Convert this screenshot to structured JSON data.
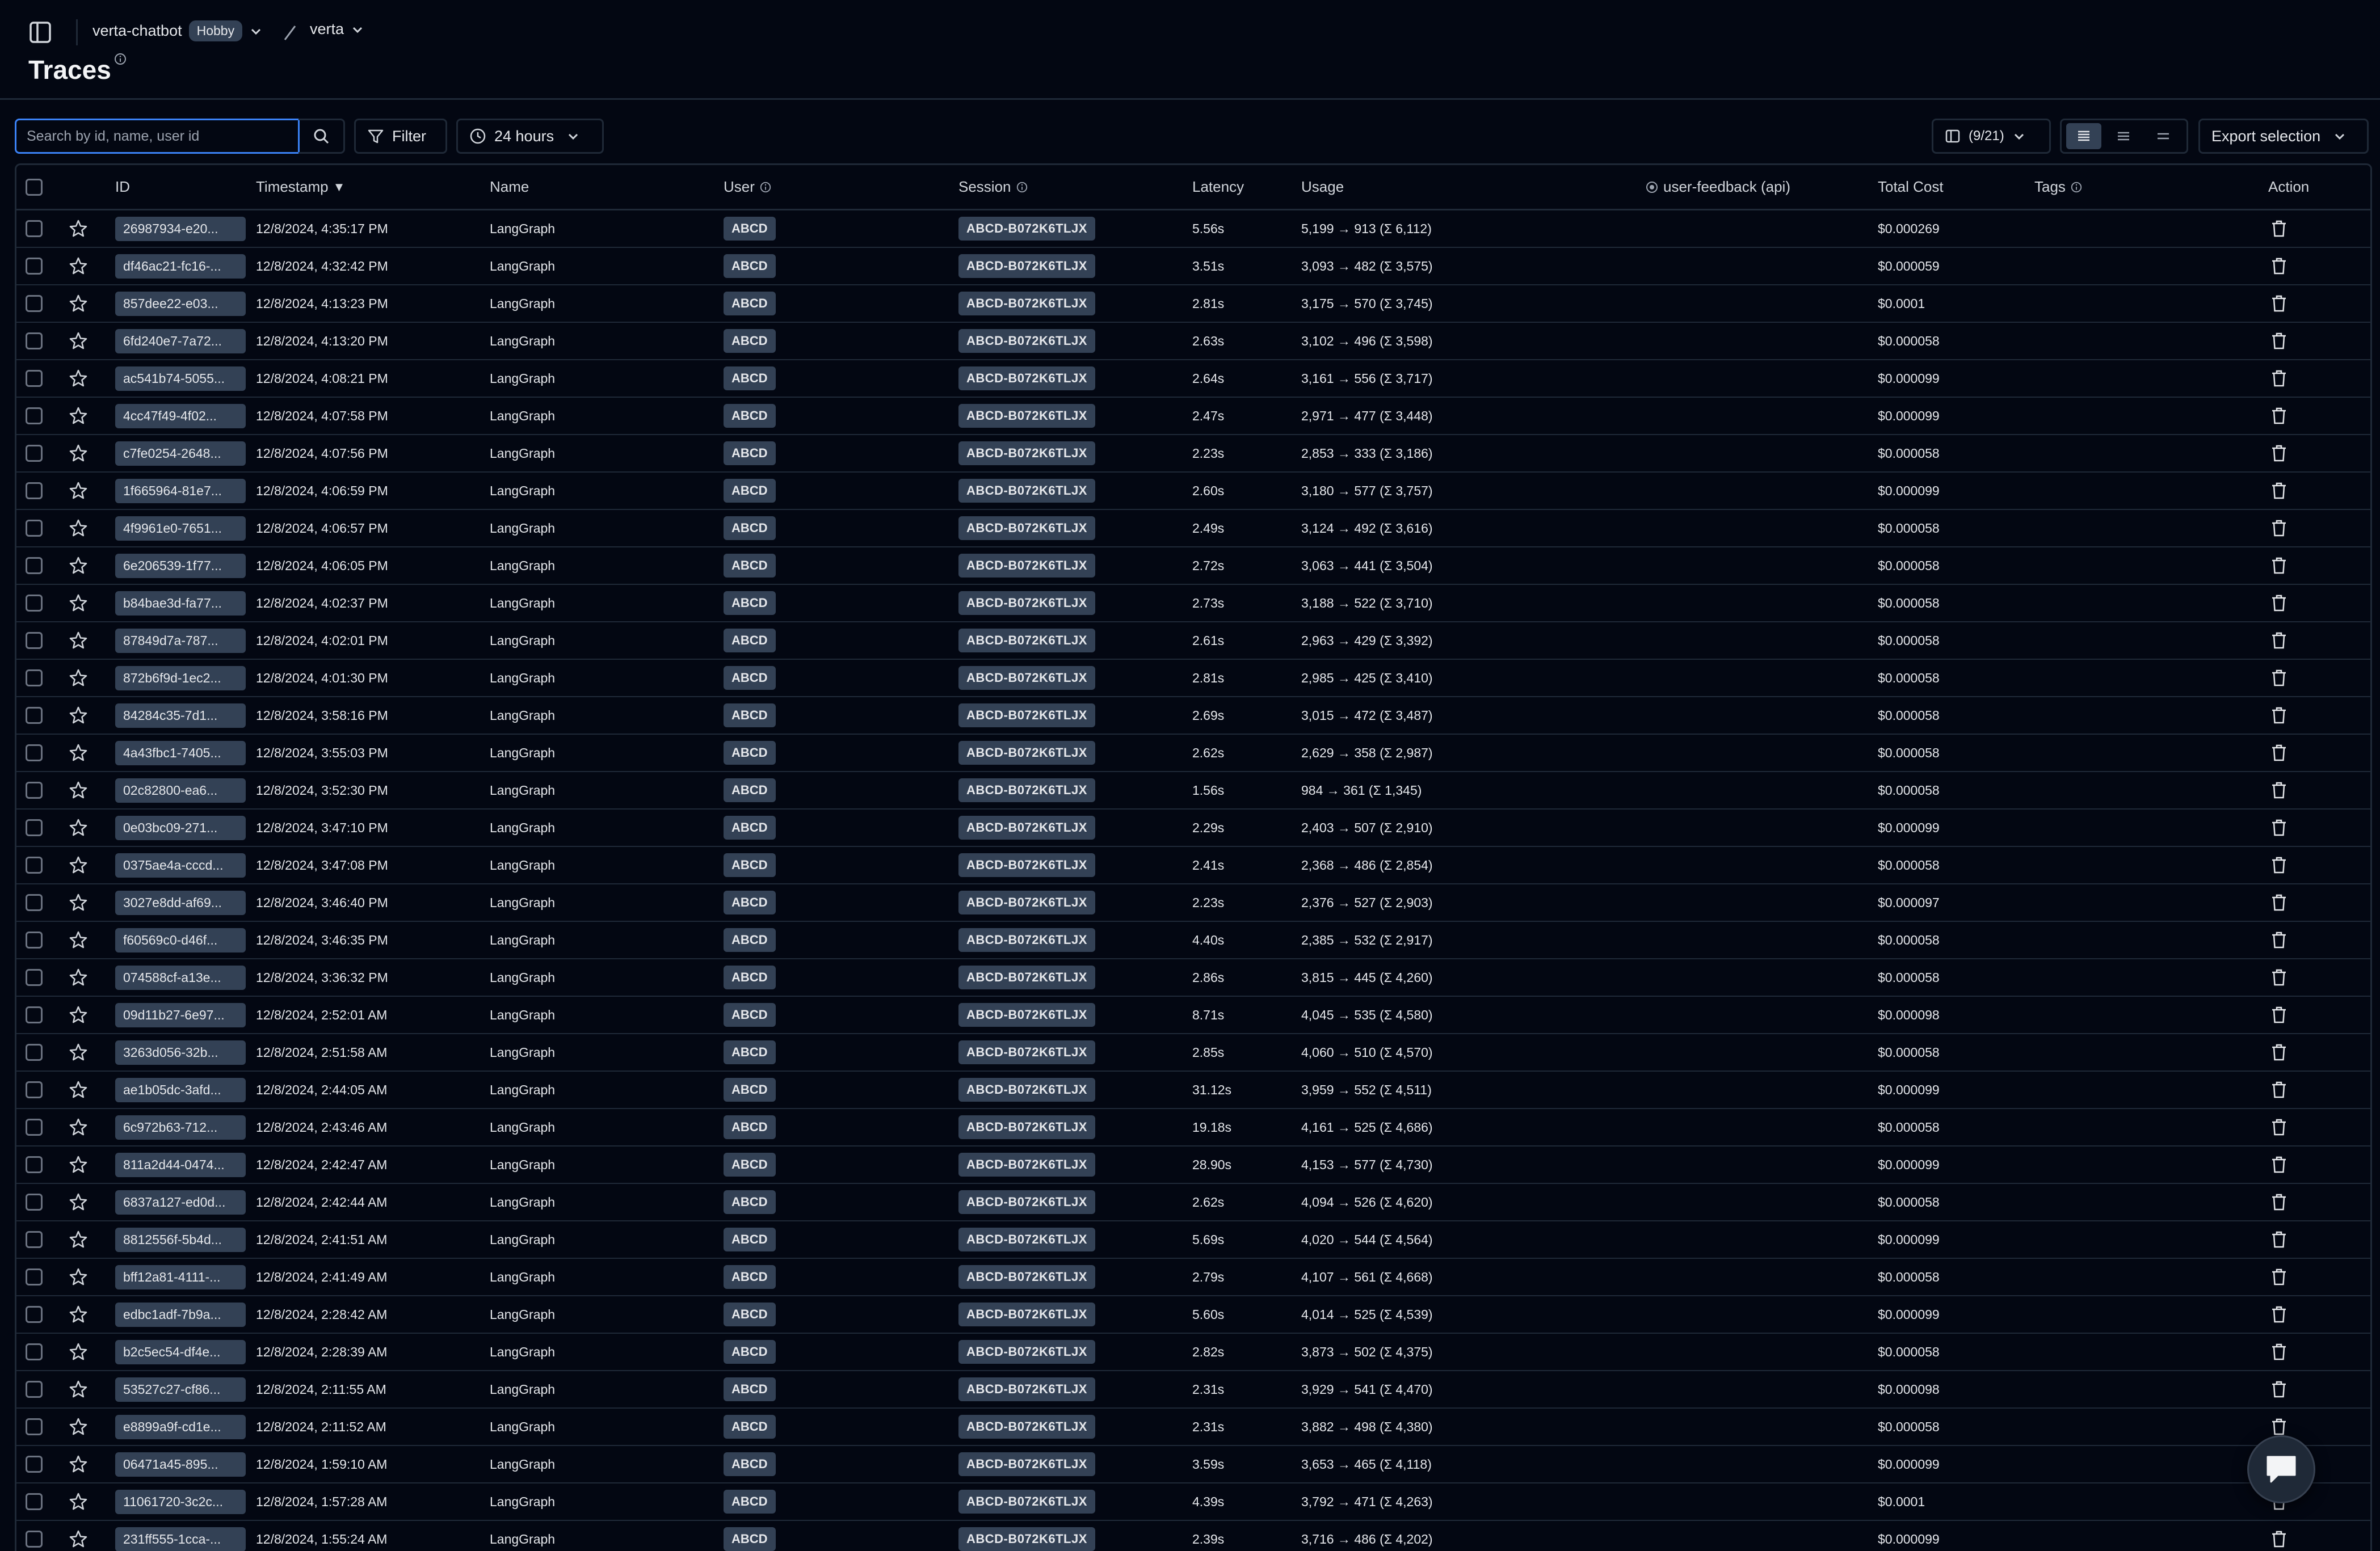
{
  "breadcrumb": {
    "project": "verta-chatbot",
    "plan_badge": "Hobby",
    "environment": "verta"
  },
  "page": {
    "title": "Traces"
  },
  "toolbar": {
    "search_placeholder": "Search by id, name, user id",
    "filter_label": "Filter",
    "time_range_label": "24 hours",
    "columns_label": "(9/21)",
    "density_options": [
      "table-density-default",
      "table-density-compact",
      "table-density-dense"
    ],
    "export_label": "Export selection"
  },
  "table": {
    "columns": {
      "id": "ID",
      "timestamp": "Timestamp",
      "timestamp_sort": "▼",
      "name": "Name",
      "user": "User",
      "session": "Session",
      "latency": "Latency",
      "usage": "Usage",
      "feedback": "user-feedback (api)",
      "total_cost": "Total Cost",
      "tags": "Tags",
      "action": "Action"
    },
    "rows": [
      {
        "id": "26987934-e20...",
        "timestamp": "12/8/2024, 4:35:17 PM",
        "name": "LangGraph",
        "user": "ABCD",
        "session": "ABCD-B072K6TLJX",
        "latency": "5.56s",
        "usage": "5,199 → 913 (Σ 6,112)",
        "cost": "$0.000269"
      },
      {
        "id": "df46ac21-fc16-...",
        "timestamp": "12/8/2024, 4:32:42 PM",
        "name": "LangGraph",
        "user": "ABCD",
        "session": "ABCD-B072K6TLJX",
        "latency": "3.51s",
        "usage": "3,093 → 482 (Σ 3,575)",
        "cost": "$0.000059"
      },
      {
        "id": "857dee22-e03...",
        "timestamp": "12/8/2024, 4:13:23 PM",
        "name": "LangGraph",
        "user": "ABCD",
        "session": "ABCD-B072K6TLJX",
        "latency": "2.81s",
        "usage": "3,175 → 570 (Σ 3,745)",
        "cost": "$0.0001"
      },
      {
        "id": "6fd240e7-7a72...",
        "timestamp": "12/8/2024, 4:13:20 PM",
        "name": "LangGraph",
        "user": "ABCD",
        "session": "ABCD-B072K6TLJX",
        "latency": "2.63s",
        "usage": "3,102 → 496 (Σ 3,598)",
        "cost": "$0.000058"
      },
      {
        "id": "ac541b74-5055...",
        "timestamp": "12/8/2024, 4:08:21 PM",
        "name": "LangGraph",
        "user": "ABCD",
        "session": "ABCD-B072K6TLJX",
        "latency": "2.64s",
        "usage": "3,161 → 556 (Σ 3,717)",
        "cost": "$0.000099"
      },
      {
        "id": "4cc47f49-4f02...",
        "timestamp": "12/8/2024, 4:07:58 PM",
        "name": "LangGraph",
        "user": "ABCD",
        "session": "ABCD-B072K6TLJX",
        "latency": "2.47s",
        "usage": "2,971 → 477 (Σ 3,448)",
        "cost": "$0.000099"
      },
      {
        "id": "c7fe0254-2648...",
        "timestamp": "12/8/2024, 4:07:56 PM",
        "name": "LangGraph",
        "user": "ABCD",
        "session": "ABCD-B072K6TLJX",
        "latency": "2.23s",
        "usage": "2,853 → 333 (Σ 3,186)",
        "cost": "$0.000058"
      },
      {
        "id": "1f665964-81e7...",
        "timestamp": "12/8/2024, 4:06:59 PM",
        "name": "LangGraph",
        "user": "ABCD",
        "session": "ABCD-B072K6TLJX",
        "latency": "2.60s",
        "usage": "3,180 → 577 (Σ 3,757)",
        "cost": "$0.000099"
      },
      {
        "id": "4f9961e0-7651...",
        "timestamp": "12/8/2024, 4:06:57 PM",
        "name": "LangGraph",
        "user": "ABCD",
        "session": "ABCD-B072K6TLJX",
        "latency": "2.49s",
        "usage": "3,124 → 492 (Σ 3,616)",
        "cost": "$0.000058"
      },
      {
        "id": "6e206539-1f77...",
        "timestamp": "12/8/2024, 4:06:05 PM",
        "name": "LangGraph",
        "user": "ABCD",
        "session": "ABCD-B072K6TLJX",
        "latency": "2.72s",
        "usage": "3,063 → 441 (Σ 3,504)",
        "cost": "$0.000058"
      },
      {
        "id": "b84bae3d-fa77...",
        "timestamp": "12/8/2024, 4:02:37 PM",
        "name": "LangGraph",
        "user": "ABCD",
        "session": "ABCD-B072K6TLJX",
        "latency": "2.73s",
        "usage": "3,188 → 522 (Σ 3,710)",
        "cost": "$0.000058"
      },
      {
        "id": "87849d7a-787...",
        "timestamp": "12/8/2024, 4:02:01 PM",
        "name": "LangGraph",
        "user": "ABCD",
        "session": "ABCD-B072K6TLJX",
        "latency": "2.61s",
        "usage": "2,963 → 429 (Σ 3,392)",
        "cost": "$0.000058"
      },
      {
        "id": "872b6f9d-1ec2...",
        "timestamp": "12/8/2024, 4:01:30 PM",
        "name": "LangGraph",
        "user": "ABCD",
        "session": "ABCD-B072K6TLJX",
        "latency": "2.81s",
        "usage": "2,985 → 425 (Σ 3,410)",
        "cost": "$0.000058"
      },
      {
        "id": "84284c35-7d1...",
        "timestamp": "12/8/2024, 3:58:16 PM",
        "name": "LangGraph",
        "user": "ABCD",
        "session": "ABCD-B072K6TLJX",
        "latency": "2.69s",
        "usage": "3,015 → 472 (Σ 3,487)",
        "cost": "$0.000058"
      },
      {
        "id": "4a43fbc1-7405...",
        "timestamp": "12/8/2024, 3:55:03 PM",
        "name": "LangGraph",
        "user": "ABCD",
        "session": "ABCD-B072K6TLJX",
        "latency": "2.62s",
        "usage": "2,629 → 358 (Σ 2,987)",
        "cost": "$0.000058"
      },
      {
        "id": "02c82800-ea6...",
        "timestamp": "12/8/2024, 3:52:30 PM",
        "name": "LangGraph",
        "user": "ABCD",
        "session": "ABCD-B072K6TLJX",
        "latency": "1.56s",
        "usage": "984 → 361 (Σ 1,345)",
        "cost": "$0.000058"
      },
      {
        "id": "0e03bc09-271...",
        "timestamp": "12/8/2024, 3:47:10 PM",
        "name": "LangGraph",
        "user": "ABCD",
        "session": "ABCD-B072K6TLJX",
        "latency": "2.29s",
        "usage": "2,403 → 507 (Σ 2,910)",
        "cost": "$0.000099"
      },
      {
        "id": "0375ae4a-cccd...",
        "timestamp": "12/8/2024, 3:47:08 PM",
        "name": "LangGraph",
        "user": "ABCD",
        "session": "ABCD-B072K6TLJX",
        "latency": "2.41s",
        "usage": "2,368 → 486 (Σ 2,854)",
        "cost": "$0.000058"
      },
      {
        "id": "3027e8dd-af69...",
        "timestamp": "12/8/2024, 3:46:40 PM",
        "name": "LangGraph",
        "user": "ABCD",
        "session": "ABCD-B072K6TLJX",
        "latency": "2.23s",
        "usage": "2,376 → 527 (Σ 2,903)",
        "cost": "$0.000097"
      },
      {
        "id": "f60569c0-d46f...",
        "timestamp": "12/8/2024, 3:46:35 PM",
        "name": "LangGraph",
        "user": "ABCD",
        "session": "ABCD-B072K6TLJX",
        "latency": "4.40s",
        "usage": "2,385 → 532 (Σ 2,917)",
        "cost": "$0.000058"
      },
      {
        "id": "074588cf-a13e...",
        "timestamp": "12/8/2024, 3:36:32 PM",
        "name": "LangGraph",
        "user": "ABCD",
        "session": "ABCD-B072K6TLJX",
        "latency": "2.86s",
        "usage": "3,815 → 445 (Σ 4,260)",
        "cost": "$0.000058"
      },
      {
        "id": "09d11b27-6e97...",
        "timestamp": "12/8/2024, 2:52:01 AM",
        "name": "LangGraph",
        "user": "ABCD",
        "session": "ABCD-B072K6TLJX",
        "latency": "8.71s",
        "usage": "4,045 → 535 (Σ 4,580)",
        "cost": "$0.000098"
      },
      {
        "id": "3263d056-32b...",
        "timestamp": "12/8/2024, 2:51:58 AM",
        "name": "LangGraph",
        "user": "ABCD",
        "session": "ABCD-B072K6TLJX",
        "latency": "2.85s",
        "usage": "4,060 → 510 (Σ 4,570)",
        "cost": "$0.000058"
      },
      {
        "id": "ae1b05dc-3afd...",
        "timestamp": "12/8/2024, 2:44:05 AM",
        "name": "LangGraph",
        "user": "ABCD",
        "session": "ABCD-B072K6TLJX",
        "latency": "31.12s",
        "usage": "3,959 → 552 (Σ 4,511)",
        "cost": "$0.000099"
      },
      {
        "id": "6c972b63-712...",
        "timestamp": "12/8/2024, 2:43:46 AM",
        "name": "LangGraph",
        "user": "ABCD",
        "session": "ABCD-B072K6TLJX",
        "latency": "19.18s",
        "usage": "4,161 → 525 (Σ 4,686)",
        "cost": "$0.000058"
      },
      {
        "id": "811a2d44-0474...",
        "timestamp": "12/8/2024, 2:42:47 AM",
        "name": "LangGraph",
        "user": "ABCD",
        "session": "ABCD-B072K6TLJX",
        "latency": "28.90s",
        "usage": "4,153 → 577 (Σ 4,730)",
        "cost": "$0.000099"
      },
      {
        "id": "6837a127-ed0d...",
        "timestamp": "12/8/2024, 2:42:44 AM",
        "name": "LangGraph",
        "user": "ABCD",
        "session": "ABCD-B072K6TLJX",
        "latency": "2.62s",
        "usage": "4,094 → 526 (Σ 4,620)",
        "cost": "$0.000058"
      },
      {
        "id": "8812556f-5b4d...",
        "timestamp": "12/8/2024, 2:41:51 AM",
        "name": "LangGraph",
        "user": "ABCD",
        "session": "ABCD-B072K6TLJX",
        "latency": "5.69s",
        "usage": "4,020 → 544 (Σ 4,564)",
        "cost": "$0.000099"
      },
      {
        "id": "bff12a81-4111-...",
        "timestamp": "12/8/2024, 2:41:49 AM",
        "name": "LangGraph",
        "user": "ABCD",
        "session": "ABCD-B072K6TLJX",
        "latency": "2.79s",
        "usage": "4,107 → 561 (Σ 4,668)",
        "cost": "$0.000058"
      },
      {
        "id": "edbc1adf-7b9a...",
        "timestamp": "12/8/2024, 2:28:42 AM",
        "name": "LangGraph",
        "user": "ABCD",
        "session": "ABCD-B072K6TLJX",
        "latency": "5.60s",
        "usage": "4,014 → 525 (Σ 4,539)",
        "cost": "$0.000099"
      },
      {
        "id": "b2c5ec54-df4e...",
        "timestamp": "12/8/2024, 2:28:39 AM",
        "name": "LangGraph",
        "user": "ABCD",
        "session": "ABCD-B072K6TLJX",
        "latency": "2.82s",
        "usage": "3,873 → 502 (Σ 4,375)",
        "cost": "$0.000058"
      },
      {
        "id": "53527c27-cf86...",
        "timestamp": "12/8/2024, 2:11:55 AM",
        "name": "LangGraph",
        "user": "ABCD",
        "session": "ABCD-B072K6TLJX",
        "latency": "2.31s",
        "usage": "3,929 → 541 (Σ 4,470)",
        "cost": "$0.000098"
      },
      {
        "id": "e8899a9f-cd1e...",
        "timestamp": "12/8/2024, 2:11:52 AM",
        "name": "LangGraph",
        "user": "ABCD",
        "session": "ABCD-B072K6TLJX",
        "latency": "2.31s",
        "usage": "3,882 → 498 (Σ 4,380)",
        "cost": "$0.000058"
      },
      {
        "id": "06471a45-895...",
        "timestamp": "12/8/2024, 1:59:10 AM",
        "name": "LangGraph",
        "user": "ABCD",
        "session": "ABCD-B072K6TLJX",
        "latency": "3.59s",
        "usage": "3,653 → 465 (Σ 4,118)",
        "cost": "$0.000099"
      },
      {
        "id": "11061720-3c2c...",
        "timestamp": "12/8/2024, 1:57:28 AM",
        "name": "LangGraph",
        "user": "ABCD",
        "session": "ABCD-B072K6TLJX",
        "latency": "4.39s",
        "usage": "3,792 → 471 (Σ 4,263)",
        "cost": "$0.0001"
      },
      {
        "id": "231ff555-1cca-...",
        "timestamp": "12/8/2024, 1:55:24 AM",
        "name": "LangGraph",
        "user": "ABCD",
        "session": "ABCD-B072K6TLJX",
        "latency": "2.39s",
        "usage": "3,716 → 486 (Σ 4,202)",
        "cost": "$0.000099"
      }
    ]
  },
  "colors": {
    "background": "#030712",
    "border": "#1f2937",
    "chip": "#334155",
    "focus": "#3b82f6"
  },
  "icons": {
    "sidebar_toggle": "sidebar-toggle-icon",
    "search": "search-icon",
    "filter": "filter-icon",
    "clock": "clock-icon",
    "columns": "columns-icon",
    "star": "star-icon",
    "trash": "trash-icon",
    "chat": "chat-icon"
  }
}
